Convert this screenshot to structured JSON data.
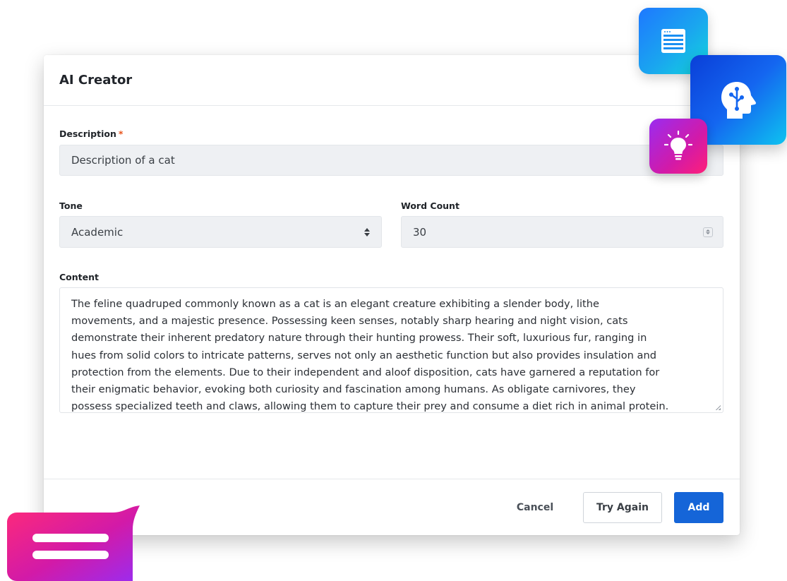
{
  "dialog": {
    "title": "AI Creator"
  },
  "description": {
    "label": "Description",
    "required_marker": "*",
    "value": "Description of a cat"
  },
  "tone": {
    "label": "Tone",
    "selected": "Academic"
  },
  "word_count": {
    "label": "Word Count",
    "value": "30"
  },
  "content": {
    "label": "Content",
    "lines": [
      "The feline quadruped commonly known as a cat is an elegant creature exhibiting a slender body, lithe",
      "movements, and a majestic presence. Possessing keen senses, notably sharp hearing and night vision, cats",
      "demonstrate their inherent predatory nature through their hunting prowess. Their soft, luxurious fur, ranging in",
      "hues from solid colors to intricate patterns, serves not only an aesthetic function but also provides insulation and",
      "protection from the elements. Due to their independent and aloof disposition, cats have garnered a reputation for",
      "their enigmatic behavior, evoking both curiosity and fascination among humans. As obligate carnivores, they",
      "possess specialized teeth and claws, allowing them to capture their prey and consume a diet rich in animal protein."
    ]
  },
  "footer": {
    "cancel_label": "Cancel",
    "try_again_label": "Try Again",
    "add_label": "Add"
  },
  "colors": {
    "primary": "#1565d8",
    "required": "#e8541c",
    "input_bg": "#eef0f3"
  },
  "icons": {
    "browser": "browser-window-icon",
    "brain": "head-circuit-icon",
    "bulb": "lightbulb-icon",
    "chat": "chat-bubble-icon"
  }
}
